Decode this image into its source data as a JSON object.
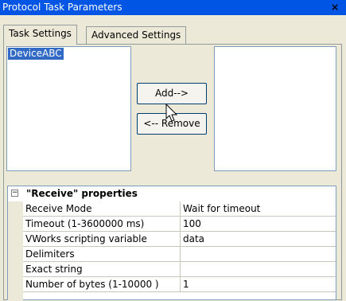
{
  "window": {
    "title": "Protocol Task Parameters",
    "close_glyph": "×"
  },
  "tabs": [
    {
      "label": "Task Settings",
      "active": true
    },
    {
      "label": "Advanced Settings",
      "active": false
    }
  ],
  "available_list": {
    "items": [
      "DeviceABC"
    ],
    "selected": "DeviceABC"
  },
  "selected_list": {
    "items": []
  },
  "buttons": {
    "add": "Add-->",
    "remove": "<-- Remove"
  },
  "properties": {
    "category": "\"Receive\" properties",
    "collapse_glyph": "−",
    "rows": [
      {
        "name": "Receive Mode",
        "value": "Wait for timeout"
      },
      {
        "name": "Timeout (1-3600000 ms)",
        "value": "100"
      },
      {
        "name": "VWorks scripting variable",
        "value": "data"
      },
      {
        "name": "Delimiters",
        "value": ""
      },
      {
        "name": "Exact string",
        "value": ""
      },
      {
        "name": "Number of bytes (1-10000 )",
        "value": "1"
      }
    ]
  },
  "colors": {
    "titlebar": "#0055e5",
    "selection": "#316ac5",
    "dialog_bg": "#ece9d8"
  },
  "icons": {
    "cursor": "arrow-pointer-icon"
  }
}
